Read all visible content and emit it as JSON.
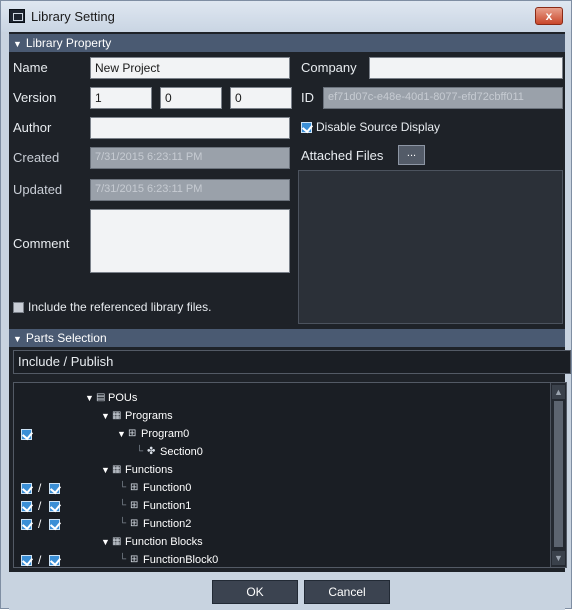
{
  "window": {
    "title": "Library Setting",
    "close_glyph": "x"
  },
  "library_property": {
    "header": "Library Property",
    "name_label": "Name",
    "name_value": "New Project",
    "company_label": "Company",
    "company_value": "",
    "version_label": "Version",
    "version_major": "1",
    "version_minor": "0",
    "version_patch": "0",
    "id_label": "ID",
    "id_value": "ef71d07c-e48e-40d1-8077-efd72cbff011",
    "author_label": "Author",
    "author_value": "",
    "disable_source_label": "Disable Source Display",
    "disable_source_checked": true,
    "created_label": "Created",
    "created_value": "7/31/2015 6:23:11 PM",
    "attached_files_label": "Attached Files",
    "attached_files_button": "...",
    "updated_label": "Updated",
    "updated_value": "7/31/2015 6:23:11 PM",
    "comment_label": "Comment",
    "comment_value": "",
    "include_referenced_label": "Include the referenced library files.",
    "include_referenced_checked": false
  },
  "parts_selection": {
    "header": "Parts Selection",
    "include_publish_label": "Include / Publish",
    "tree": [
      {
        "label": "POUs",
        "icon": "pou-icon",
        "level": 0,
        "expanded": true,
        "include": null,
        "publish": null
      },
      {
        "label": "Programs",
        "icon": "folder-icon",
        "level": 1,
        "expanded": true,
        "include": null,
        "publish": null
      },
      {
        "label": "Program0",
        "icon": "program-icon",
        "level": 2,
        "expanded": true,
        "include": true,
        "publish": null
      },
      {
        "label": "Section0",
        "icon": "section-icon",
        "level": 3,
        "expanded": null,
        "include": null,
        "publish": null
      },
      {
        "label": "Functions",
        "icon": "folder-icon",
        "level": 1,
        "expanded": true,
        "include": null,
        "publish": null
      },
      {
        "label": "Function0",
        "icon": "function-icon",
        "level": 2,
        "expanded": null,
        "include": true,
        "publish": true
      },
      {
        "label": "Function1",
        "icon": "function-icon",
        "level": 2,
        "expanded": null,
        "include": true,
        "publish": true
      },
      {
        "label": "Function2",
        "icon": "function-icon",
        "level": 2,
        "expanded": null,
        "include": true,
        "publish": true
      },
      {
        "label": "Function Blocks",
        "icon": "folder-icon",
        "level": 1,
        "expanded": true,
        "include": null,
        "publish": null
      },
      {
        "label": "FunctionBlock0",
        "icon": "function-block-icon",
        "level": 2,
        "expanded": null,
        "include": true,
        "publish": true
      }
    ]
  },
  "footer": {
    "ok_label": "OK",
    "cancel_label": "Cancel"
  },
  "colors": {
    "dialog_background": "#1e2228",
    "section_header": "#4a5a72",
    "checkbox_checked": "#3b8fd6"
  }
}
